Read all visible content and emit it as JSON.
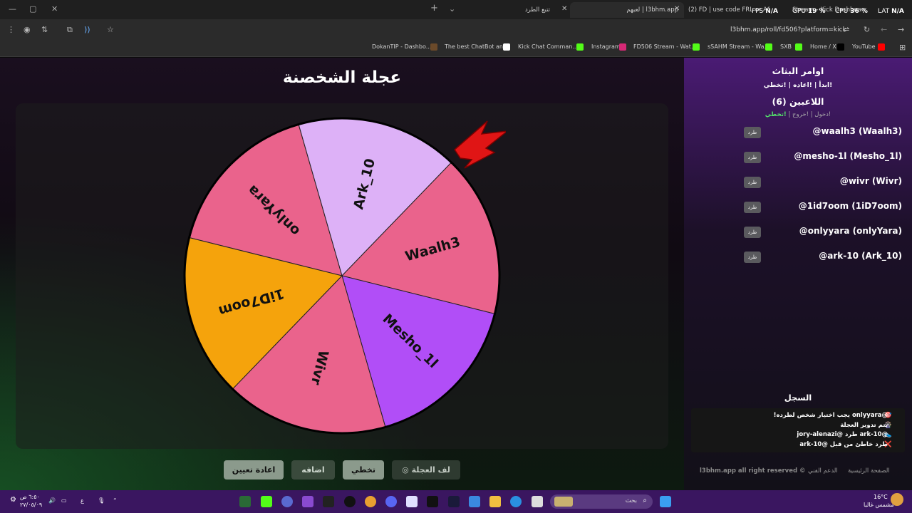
{
  "browser": {
    "tabs": [
      {
        "label": "تتبع الطرد"
      },
      {
        "label": "l3bhm.app | لعبهم"
      },
      {
        "label": "(2) FD | use code FRL or AST"
      },
      {
        "label": "Stream - Kick Dashboard"
      }
    ],
    "hud": {
      "fps_label": "FPS",
      "fps_value": "N/A",
      "gpu_label": "GPU",
      "gpu_value": "19 %",
      "cpu_label": "CPU",
      "cpu_value": "36 %",
      "lat_label": "LAT",
      "lat_value": "N/A"
    },
    "url": "l3bhm.app/roll/fd506?platform=kick",
    "bookmarks": [
      {
        "label": "DokanTIP - Dashbo...",
        "color": "#6b4a2a"
      },
      {
        "label": "The best ChatBot an...",
        "color": "#ffffff"
      },
      {
        "label": "Kick Chat Comman...",
        "color": "#53fc18"
      },
      {
        "label": "Instagram",
        "color": "#d62976"
      },
      {
        "label": "FD506 Stream - Wat...",
        "color": "#53fc18"
      },
      {
        "label": "sSAHM Stream - Wa...",
        "color": "#53fc18"
      },
      {
        "label": "SXB",
        "color": "#53fc18"
      },
      {
        "label": "Home / X",
        "color": "#000000"
      },
      {
        "label": "YouTube",
        "color": "#ff0000"
      }
    ]
  },
  "wheel": {
    "title": "عجلة الشخصنة",
    "segments": [
      {
        "name": "onlyYara",
        "color": "#ea638c"
      },
      {
        "name": "Ark_10",
        "color": "#ddb1f7"
      },
      {
        "name": "Waalh3",
        "color": "#ea638c"
      },
      {
        "name": "Mesho_1l",
        "color": "#b14ef7"
      },
      {
        "name": "Wivr",
        "color": "#ea638c"
      },
      {
        "name": "1iD7oom",
        "color": "#f5a30c"
      }
    ]
  },
  "controls": {
    "reset": "اعادة تعيين",
    "add": "اضافه",
    "skip": "تخطي",
    "spin": "لف العجلة"
  },
  "sidebar": {
    "streamer_commands_title": "اوامر البثاث",
    "streamer_commands": "!ابدأ | !اعاده | !تخطي",
    "players_title": "اللاعبين (6)",
    "join_cmd": "!دخول",
    "leave_cmd": "!خروج",
    "skip_cmd": "!تخطي",
    "kick_label": "طرد",
    "players": [
      {
        "name": "@waalh3 (Waalh3)"
      },
      {
        "name": "@mesho-1l (Mesho_1l)"
      },
      {
        "name": "@wivr (Wivr)"
      },
      {
        "name": "@1id7oom (1iD7oom)"
      },
      {
        "name": "@onlyyara (onlyYara)"
      },
      {
        "name": "@ark-10 (Ark_10)"
      }
    ],
    "log_title": "السجل",
    "log": [
      {
        "icon": "🎯",
        "text": "@onlyyara يجب اختيار شخص لطرده!"
      },
      {
        "icon": "🎡",
        "text": "يتم تدوير العجلة"
      },
      {
        "icon": "👟",
        "text": "@ark-10 طرد @jory-alenazi"
      },
      {
        "icon": "❌",
        "text": "طرد خاطئ من قبل @ark-10"
      }
    ],
    "footer_home": "الصفحة الرئيسية",
    "footer_support": "الدعم الفني",
    "footer_copyright": "l3bhm.app all right reserved ©"
  },
  "taskbar": {
    "search_placeholder": "بحث",
    "weather_temp": "16°C",
    "weather_desc": "مشمس غالبا",
    "time": "٦:٥٠ ص",
    "date": "٢٧/٠٥/٠٩",
    "lang": "ع"
  }
}
